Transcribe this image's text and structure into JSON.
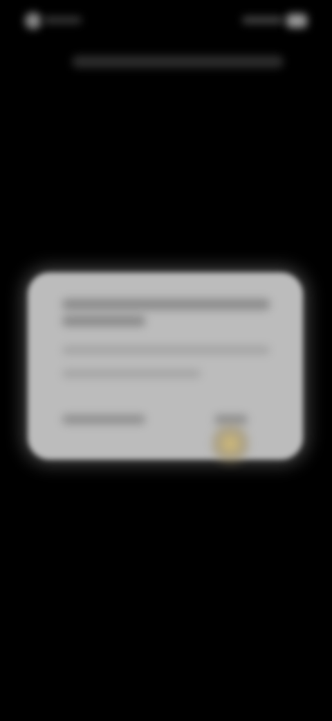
{
  "status_bar": {
    "left_icon": "circle-status-icon",
    "right_icon": "battery-icon"
  },
  "dialog": {
    "title": "",
    "message": "",
    "negative_button": "",
    "positive_button": ""
  },
  "colors": {
    "background": "#000000",
    "dialog_background": "#bcbcbc",
    "touch_indicator": "#d6bc6e"
  }
}
